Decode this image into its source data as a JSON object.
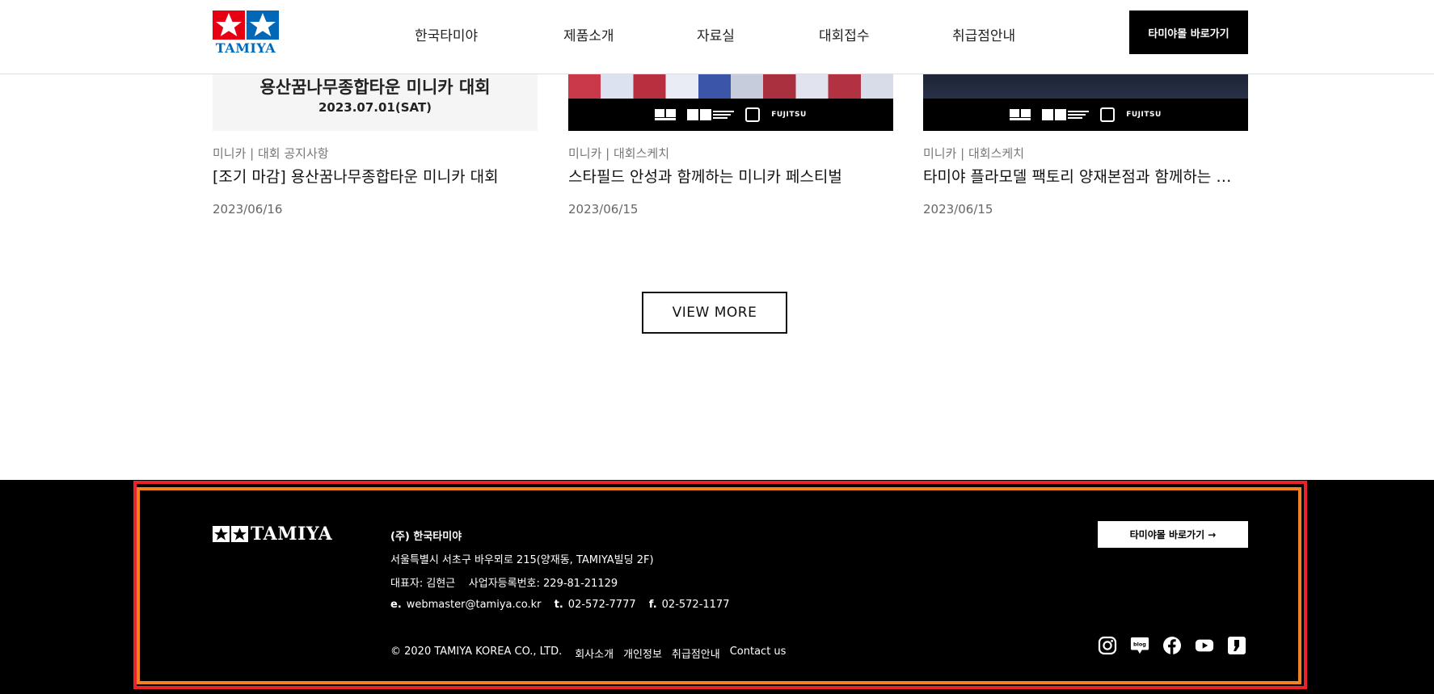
{
  "header": {
    "logo_text": "TAMIYA",
    "nav": [
      "한국타미야",
      "제품소개",
      "자료실",
      "대회접수",
      "취급점안내"
    ],
    "mall_button": "타미야몰 바로가기"
  },
  "cards": [
    {
      "thumb_title": "용산꿈나무종합타운 미니카 대회",
      "thumb_date": "2023.07.01(SAT)",
      "category": "미니카 | 대회 공지사항",
      "title": "[조기 마감] 용산꿈나무종합타운 미니카 대회",
      "date": "2023/06/16"
    },
    {
      "sponsor_text": "FUJITSU",
      "category": "미니카 | 대회스케치",
      "title": "스타필드 안성과 함께하는 미니카 페스티벌",
      "date": "2023/06/15"
    },
    {
      "sponsor_text": "FUJITSU",
      "category": "미니카 | 대회스케치",
      "title": "타미야 플라모델 팩토리 양재본점과 함께하는 …",
      "date": "2023/06/15"
    }
  ],
  "view_more": "VIEW MORE",
  "footer": {
    "logo_text": "TAMIYA",
    "company": "(주) 한국타미야",
    "address": "서울특별시 서초구 바우뫼로 215(양재동, TAMIYA빌딩 2F)",
    "ceo": "대표자: 김현근    사업자등록번호: 229-81-21129",
    "email_label": "e.",
    "email": "webmaster@tamiya.co.kr",
    "tel_label": "t.",
    "tel": "02-572-7777",
    "fax_label": "f.",
    "fax": "02-572-1177",
    "copyright": "© 2020 TAMIYA KOREA CO., LTD.",
    "links": [
      "회사소개",
      "개인정보",
      "취급점안내",
      "Contact us"
    ],
    "mall_button": "타미야몰 바로가기 →",
    "social_icons": [
      "instagram-icon",
      "blog-icon",
      "facebook-icon",
      "youtube-icon",
      "kakao-story-icon"
    ],
    "blog_label": "blog"
  },
  "colors": {
    "accent_red": "#e60012",
    "accent_blue": "#0068b7",
    "selection_outer": "#e8242a",
    "selection_inner": "#f58220"
  }
}
